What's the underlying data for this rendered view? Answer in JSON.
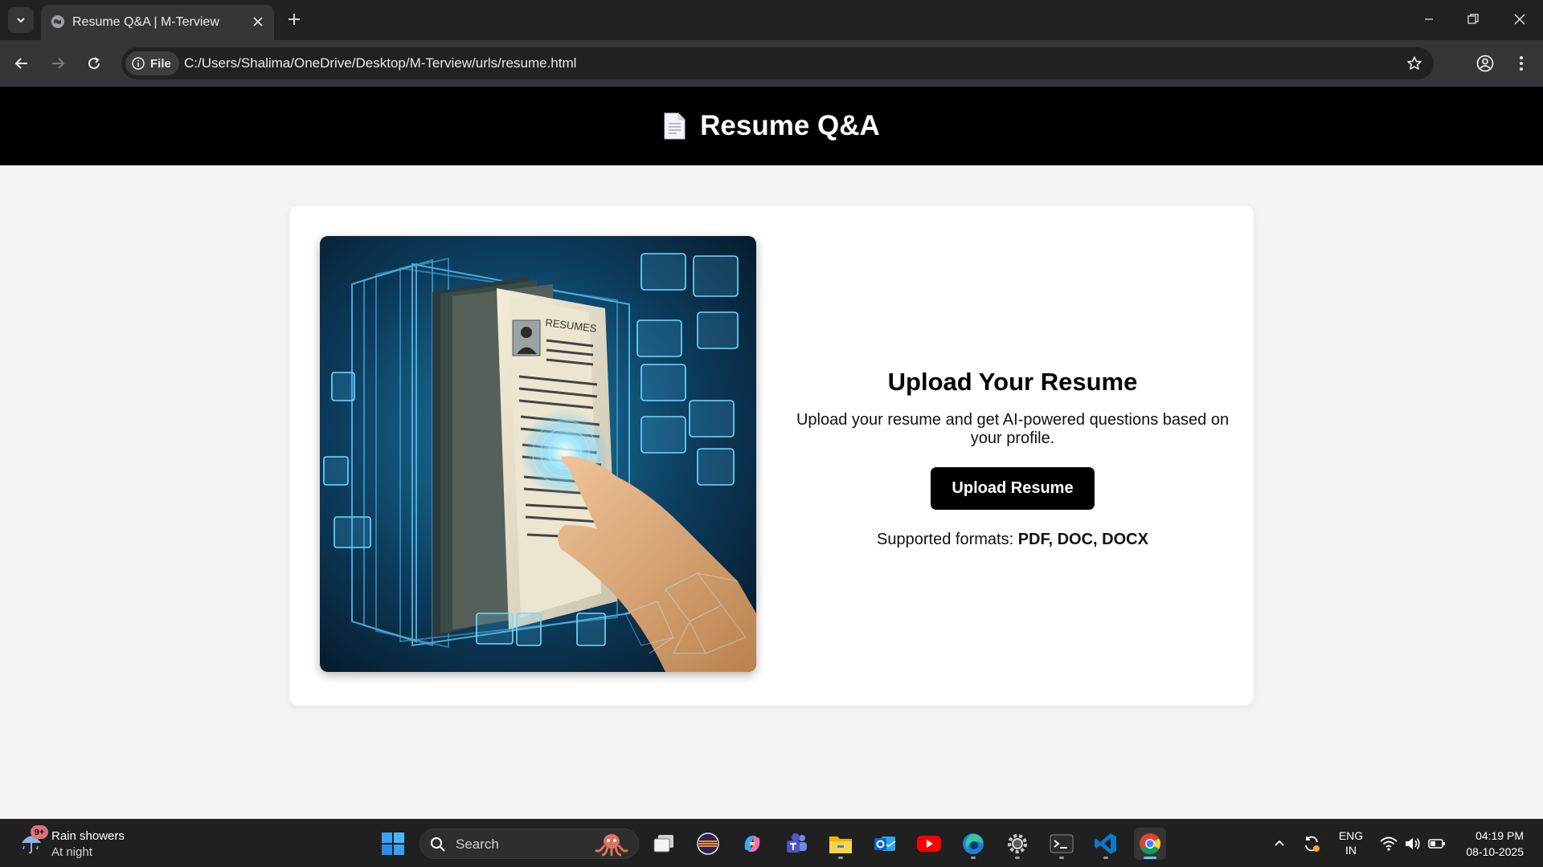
{
  "browser": {
    "tab_title": "Resume Q&A | M-Terview",
    "site_chip": "File",
    "url": "C:/Users/Shalima/OneDrive/Desktop/M-Terview/urls/resume.html"
  },
  "page": {
    "title": "Resume Q&A",
    "title_icon": "document-icon",
    "image_alt_text": "RESUMES",
    "upload": {
      "heading": "Upload Your Resume",
      "description": "Upload your resume and get AI-powered questions based on your profile.",
      "button_label": "Upload Resume",
      "formats_label": "Supported formats:",
      "formats_value": "PDF, DOC, DOCX"
    }
  },
  "taskbar": {
    "weather": {
      "badge": "9+",
      "condition": "Rain showers",
      "time_of_day": "At night"
    },
    "search_label": "Search",
    "language_line1": "ENG",
    "language_line2": "IN",
    "time": "04:19 PM",
    "date": "08-10-2025",
    "pinned_apps": [
      "task-view",
      "eclipse",
      "copilot",
      "teams",
      "file-explorer",
      "outlook",
      "youtube",
      "edge-dev",
      "settings",
      "terminal",
      "vscode",
      "chrome"
    ]
  },
  "colors": {
    "header_bg": "#000000",
    "page_bg": "#f3f3f3",
    "button_bg": "#000000",
    "chrome_dark": "#202124",
    "chrome_toolbar": "#35363a"
  }
}
